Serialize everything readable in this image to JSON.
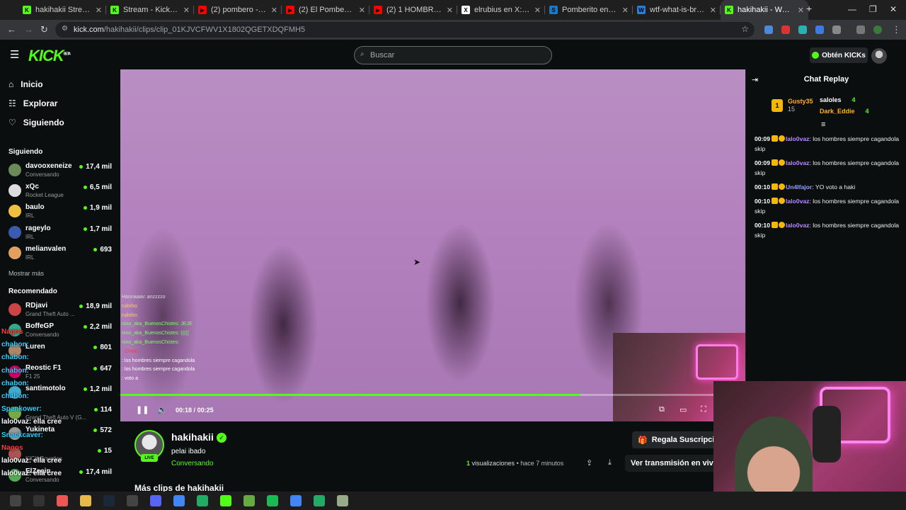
{
  "browser": {
    "tabs": [
      {
        "title": "hakihakii Stream - W",
        "color": "#53fc18",
        "glyph": "K"
      },
      {
        "title": "Stream - Kick Dashbo",
        "color": "#53fc18",
        "glyph": "K"
      },
      {
        "title": "(2) pombero - YouTu",
        "color": "#ff0000",
        "glyph": "▶"
      },
      {
        "title": "(2) El Pombero: ¿Qu",
        "color": "#ff0000",
        "glyph": "▶"
      },
      {
        "title": "(2) 1 HOMBRE VS 6 M",
        "color": "#ff0000",
        "glyph": "▶"
      },
      {
        "title": "elrubius en X: \"Miles",
        "color": "#ffffff",
        "glyph": "X"
      },
      {
        "title": "Pomberito en Steam",
        "color": "#1b79c4",
        "glyph": "S"
      },
      {
        "title": "wtf-what-is-bro-wag",
        "color": "#2f7bd8",
        "glyph": "W"
      },
      {
        "title": "hakihakii - Watch",
        "color": "#53fc18",
        "glyph": "K",
        "active": true
      }
    ],
    "url_host": "kick.com",
    "url_path": "/hakihakii/clips/clip_01KJVCFWV1X1802QGETXDQFMH5"
  },
  "kick": {
    "logo": "KICK",
    "logo_beta": "BETA",
    "search_placeholder": "Buscar",
    "get_kicks": "Obtén KICKs"
  },
  "sidebar": {
    "nav": [
      {
        "label": "Inicio",
        "icon": "home-icon"
      },
      {
        "label": "Explorar",
        "icon": "compass-icon"
      },
      {
        "label": "Siguiendo",
        "icon": "heart-icon"
      }
    ],
    "following_title": "Siguiendo",
    "following": [
      {
        "name": "davooxeneize",
        "category": "Conversando",
        "viewers": "17,4 mil"
      },
      {
        "name": "xQc",
        "category": "Rocket League",
        "viewers": "6,5 mil"
      },
      {
        "name": "baulo",
        "category": "IRL",
        "viewers": "1,9 mil"
      },
      {
        "name": "rageylo",
        "category": "IRL",
        "viewers": "1,7 mil"
      },
      {
        "name": "melianvalen",
        "category": "IRL",
        "viewers": "693"
      }
    ],
    "show_more": "Mostrar más",
    "recommended_title": "Recomendado",
    "recommended": [
      {
        "name": "RDjavi",
        "category": "Grand Theft Auto ...",
        "viewers": "18,9 mil"
      },
      {
        "name": "BoffeGP",
        "category": "Conversando",
        "viewers": "2,2 mil"
      },
      {
        "name": "Luren",
        "category": "",
        "viewers": "801"
      },
      {
        "name": "Reostic F1",
        "category": "F1 25",
        "viewers": "647"
      },
      {
        "name": "santimotolo",
        "category": "",
        "viewers": "1,2 mil"
      },
      {
        "name": "",
        "category": "Grand Theft Auto V (G...",
        "viewers": "114"
      },
      {
        "name": "Yukineta",
        "category": "",
        "viewers": "572"
      },
      {
        "name": "",
        "category": "KICK Bounties",
        "viewers": "15"
      },
      {
        "name": "ElZeein",
        "category": "Conversando",
        "viewers": "17,4 mil"
      }
    ]
  },
  "video": {
    "overlay_chat": [
      "Hannaaav: anzzzzo",
      "rulinho:",
      "rulinho:",
      "",
      "nino_aka_BuenosChistes: JEJE",
      "nino_aka_BuenosChistes: (((((",
      "",
      "nino_aka_BuenosChistes:",
      ": CHAD",
      ": los hombres siempre cagandola",
      ": los hombres siempre cagandola",
      ": voto a"
    ],
    "time_current": "00:18",
    "time_sep": "/",
    "time_total": "00:25",
    "progress": 0.736
  },
  "clip": {
    "streamer": "hakihakii",
    "live_badge": "LIVE",
    "title": "pelai ibado",
    "category": "Conversando",
    "views_count": "1",
    "views_label": "visualizaciones",
    "age": "• hace 7 minutos",
    "gift_sub": "Regala Suscripcio",
    "watch_live": "Ver transmisión en vivo",
    "more_clips": "Más clips de hakihakii"
  },
  "chat": {
    "title": "Chat Replay",
    "leaderboard": [
      {
        "name": "Gusty35",
        "count": "15"
      },
      {
        "name": "saloles",
        "count": "4"
      },
      {
        "name": "Dark_Eddie",
        "count": "4"
      }
    ],
    "messages": [
      {
        "time": "00:09",
        "user": "lalo0vaz",
        "text": "los hombres siempre cagandola skip"
      },
      {
        "time": "00:09",
        "user": "lalo0vaz",
        "text": "los hombres siempre cagandola skip"
      },
      {
        "time": "00:10",
        "user": "Un4lfajor",
        "text": "YO voto a haki"
      },
      {
        "time": "00:10",
        "user": "lalo0vaz",
        "text": "los hombres siempre cagandola skip"
      },
      {
        "time": "00:10",
        "user": "lalo0vaz",
        "text": "los hombres siempre cagandola skip"
      }
    ]
  },
  "stream_side_chat": [
    "Nagos",
    "chabon:",
    "chabon:",
    "chabon:",
    "chabon:",
    "chabon:",
    "",
    "Spankower:",
    "lalo0vaz: ella cree",
    "Snackcaver:",
    "Nagos",
    "lalo0vaz: ella cree",
    "lalo0vaz: ella cree"
  ]
}
